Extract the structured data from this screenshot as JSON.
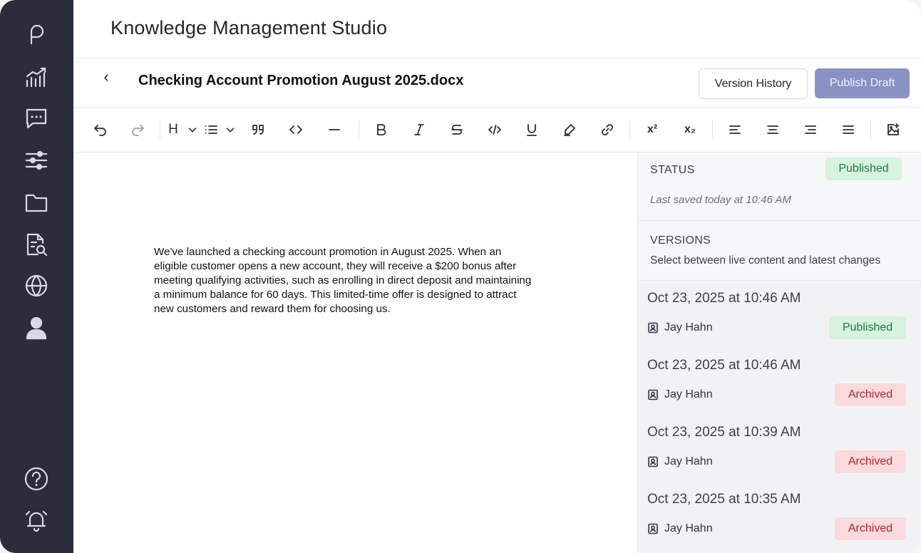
{
  "app": {
    "title": "Knowledge Management Studio"
  },
  "sidebar": {
    "items": [
      {
        "icon": "logo-p-icon"
      },
      {
        "icon": "analytics-icon"
      },
      {
        "icon": "chat-icon"
      },
      {
        "icon": "sliders-icon"
      },
      {
        "icon": "folder-icon"
      },
      {
        "icon": "document-search-icon"
      },
      {
        "icon": "globe-icon"
      },
      {
        "icon": "user-icon"
      },
      {
        "icon": "help-icon"
      },
      {
        "icon": "alarm-bell-icon"
      }
    ]
  },
  "document": {
    "back_glyph": "‹",
    "title": "Checking Account Promotion August 2025.docx",
    "version_history_label": "Version History",
    "publish_label": "Publish Draft",
    "body": "We've launched a checking account promotion in August 2025. When an eligible customer opens a new account, they will receive a $200 bonus after meeting qualifying activities, such as enrolling in direct deposit and maintaining a minimum balance for 60 days. This limited-time offer is designed to attract new customers and reward them for choosing us."
  },
  "toolbar": {
    "heading_label": "H",
    "superscript_label": "x²",
    "subscript_label": "x₂"
  },
  "panel": {
    "status_label": "STATUS",
    "status_value": "Published",
    "last_saved": "Last saved today at 10:46 AM",
    "versions_label": "VERSIONS",
    "versions_subtitle": "Select between live content and latest changes",
    "versions": [
      {
        "date": "Oct 23, 2025 at 10:46 AM",
        "user": "Jay Hahn",
        "status": "Published"
      },
      {
        "date": "Oct 23, 2025 at 10:46 AM",
        "user": "Jay Hahn",
        "status": "Archived"
      },
      {
        "date": "Oct 23, 2025 at 10:39 AM",
        "user": "Jay Hahn",
        "status": "Archived"
      },
      {
        "date": "Oct 23, 2025 at 10:35 AM",
        "user": "Jay Hahn",
        "status": "Archived"
      }
    ]
  },
  "colors": {
    "sidebar_bg": "#2b2d3d",
    "publish_btn": "#8a92c4",
    "published_badge_bg": "#d7f2df",
    "published_badge_text": "#1f7a3e",
    "archived_badge_bg": "#fadadd",
    "archived_badge_text": "#b42331"
  }
}
